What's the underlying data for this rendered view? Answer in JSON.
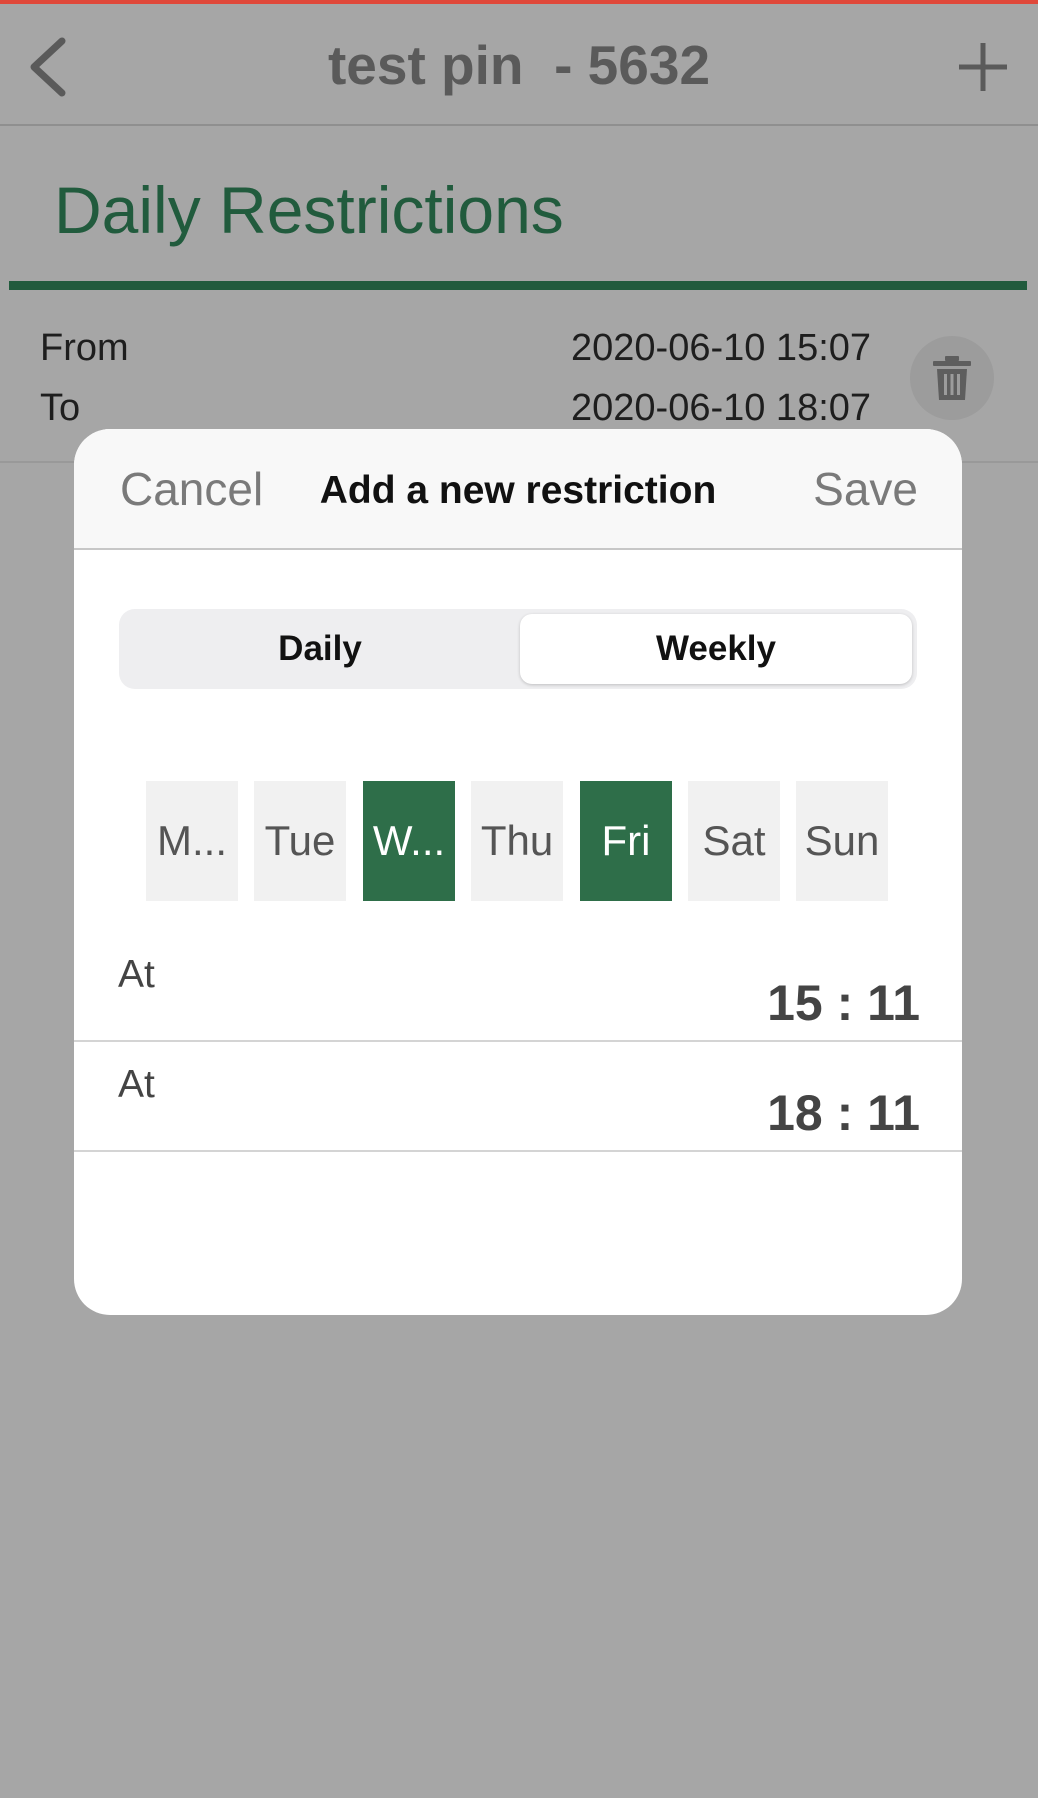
{
  "colors": {
    "top_strip": "#e0483a",
    "accent_green": "#2e6e49",
    "dim_green": "#215b3d"
  },
  "navbar": {
    "title": "test pin  - 5632",
    "back_icon": "chevron-left-icon",
    "add_icon": "plus-icon"
  },
  "section": {
    "title": "Daily Restrictions"
  },
  "restriction_row": {
    "from_label": "From",
    "from_value": "2020-06-10 15:07",
    "to_label": "To",
    "to_value": "2020-06-10 18:07",
    "delete_icon": "trash-icon"
  },
  "modal": {
    "cancel_label": "Cancel",
    "title": "Add a new restriction",
    "save_label": "Save",
    "segments": [
      {
        "label": "Daily",
        "selected": false
      },
      {
        "label": "Weekly",
        "selected": true
      }
    ],
    "days": [
      {
        "label": "M...",
        "selected": false
      },
      {
        "label": "Tue",
        "selected": false
      },
      {
        "label": "W...",
        "selected": true
      },
      {
        "label": "Thu",
        "selected": false
      },
      {
        "label": "Fri",
        "selected": true
      },
      {
        "label": "Sat",
        "selected": false
      },
      {
        "label": "Sun",
        "selected": false
      }
    ],
    "start": {
      "label": "At",
      "value": "15 : 11"
    },
    "end": {
      "label": "At",
      "value": "18 : 11"
    }
  }
}
